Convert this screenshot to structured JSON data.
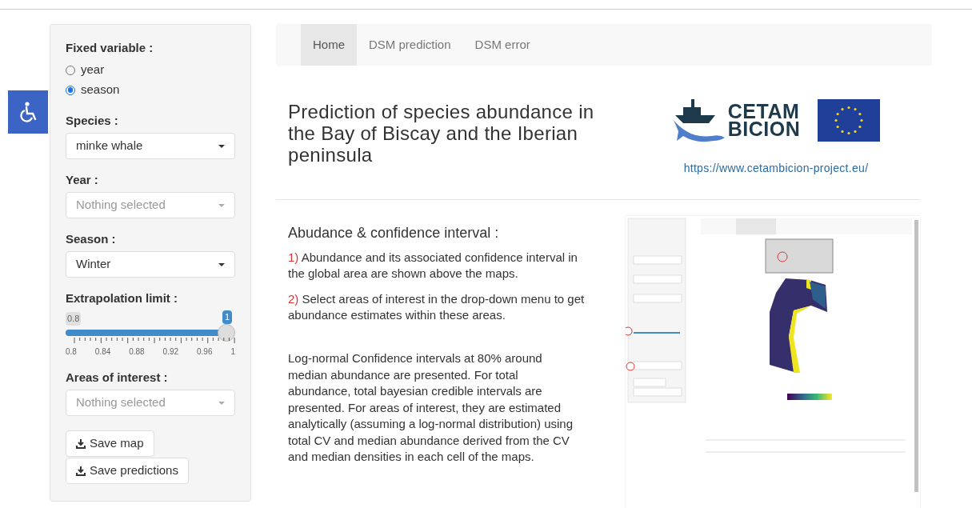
{
  "accessibility_button": {
    "kind": "wheelchair"
  },
  "sidebar": {
    "fixed_variable": {
      "label": "Fixed variable :",
      "options": [
        {
          "label": "year",
          "selected": false
        },
        {
          "label": "season",
          "selected": true
        }
      ]
    },
    "selects": [
      {
        "label": "Species :",
        "value": "minke whale"
      },
      {
        "label": "Year :",
        "placeholder": "Nothing selected"
      },
      {
        "label": "Season :",
        "value": "Winter"
      }
    ],
    "slider": {
      "label": "Extrapolation limit :",
      "min_label": "0.8",
      "value_label": "1",
      "level": 1.0,
      "ticks": [
        "0.8",
        "0.84",
        "0.88",
        "0.92",
        "0.96",
        "1"
      ]
    },
    "areas": {
      "label": "Areas of interest :",
      "placeholder": "Nothing selected"
    },
    "buttons": [
      "Save map",
      "Save predictions"
    ]
  },
  "nav": {
    "tabs": [
      {
        "label": "Home",
        "selected": true
      },
      {
        "label": "DSM prediction",
        "selected": false
      },
      {
        "label": "DSM error",
        "selected": false
      }
    ]
  },
  "header": {
    "title": "Prediction of species abundance in the Bay of Biscay and the Iberian peninsula",
    "logo_text": [
      "CETAM",
      "BICION"
    ],
    "link": "https://www.cetambicion-project.eu/"
  },
  "section": {
    "heading": "Abudance & confidence interval :",
    "items": [
      {
        "number": "1)",
        "text": "Abundance and its associated confidence interval in the global area are shown above the maps."
      },
      {
        "number": "2)",
        "text": "Select areas of interest in the drop-down menu to get abundance estimates within these areas."
      }
    ],
    "note": "Log-normal Confidence intervals at 80% around median abundance are presented. For total abundance, total bayesian credible intervals are presented. For areas of interest, they are estimated analytically (assuming a log-normal distribution) using total CV and median abundance derived from the CV and median densities in each cell of the maps."
  }
}
